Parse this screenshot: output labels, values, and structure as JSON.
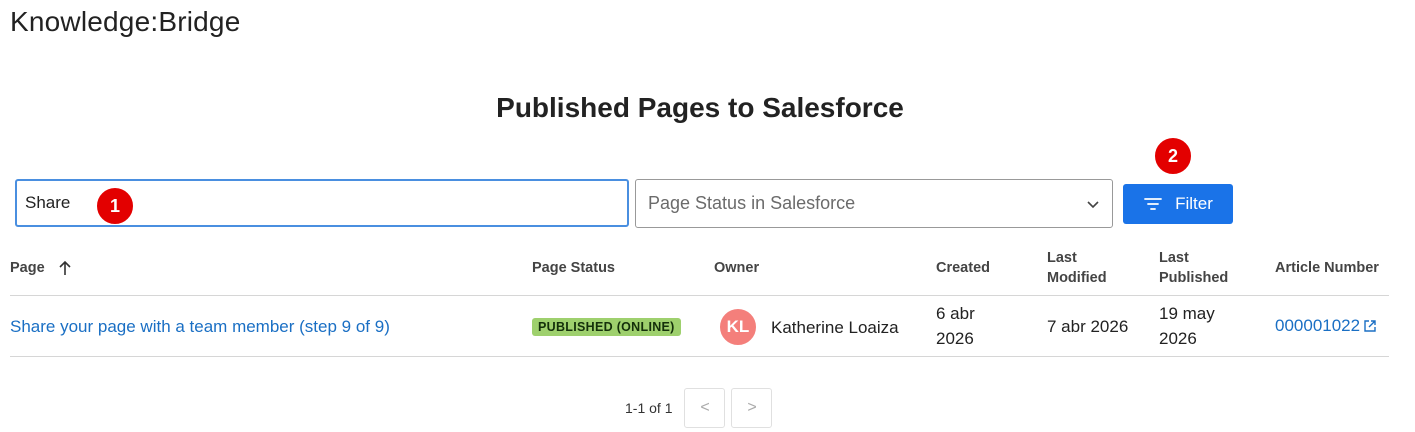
{
  "app": {
    "title": "Knowledge:Bridge"
  },
  "heading": "Published Pages to Salesforce",
  "search": {
    "value": "Share",
    "placeholder": ""
  },
  "status_filter": {
    "placeholder": "Page Status in Salesforce",
    "icon": "chevron-down-icon"
  },
  "filter_button": {
    "label": "Filter",
    "icon": "filter-icon"
  },
  "annotations": {
    "badge1": "1",
    "badge2": "2"
  },
  "table": {
    "columns": {
      "page": "Page",
      "page_status": "Page Status",
      "owner": "Owner",
      "created": "Created",
      "last_modified_1": "Last",
      "last_modified_2": "Modified",
      "last_published_1": "Last",
      "last_published_2": "Published",
      "article_number": "Article Number"
    },
    "sort": {
      "column": "Page",
      "direction": "ascending",
      "icon": "arrow-up-icon"
    },
    "rows": [
      {
        "page": "Share your page with a team member (step 9 of 9)",
        "status": "PUBLISHED (ONLINE)",
        "owner_initials": "KL",
        "owner_name": "Katherine Loaiza",
        "created_1": "6 abr",
        "created_2": "2026",
        "last_modified": "7 abr 2026",
        "last_published_1": "19 may",
        "last_published_2": "2026",
        "article_number": "000001022"
      }
    ]
  },
  "pagination": {
    "summary": "1-1 of 1",
    "prev": "<",
    "next": ">"
  },
  "colors": {
    "accent": "#1a73e8",
    "link": "#1a6fc4",
    "status_published": "#9ed06d",
    "avatar": "#f47f7b",
    "badge": "#e30000"
  }
}
